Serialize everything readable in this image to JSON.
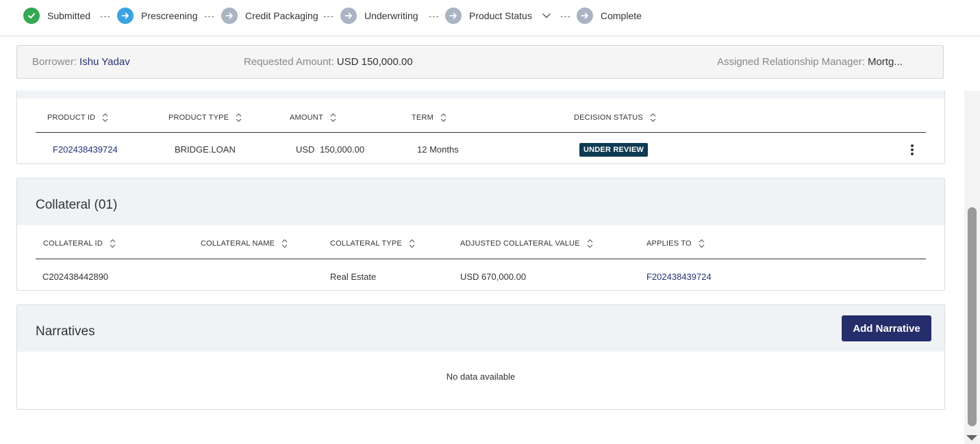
{
  "stepper": {
    "steps": [
      {
        "label": "Submitted",
        "state": "done"
      },
      {
        "label": "Prescreening",
        "state": "current"
      },
      {
        "label": "Credit Packaging",
        "state": "pending"
      },
      {
        "label": "Underwriting",
        "state": "pending"
      },
      {
        "label": "Product Status",
        "state": "pending"
      },
      {
        "label": "Complete",
        "state": "pending"
      }
    ],
    "separator": "---"
  },
  "borrower": {
    "borrower_label": "Borrower:",
    "borrower_value": "Ishu Yadav",
    "amount_label": "Requested Amount:",
    "amount_value": "USD 150,000.00",
    "manager_label": "Assigned Relationship Manager:",
    "manager_value": "Mortg..."
  },
  "products": {
    "columns": [
      "PRODUCT ID",
      "PRODUCT TYPE",
      "AMOUNT",
      "TERM",
      "DECISION STATUS"
    ],
    "rows": [
      {
        "id": "F202438439724",
        "type": "BRIDGE.LOAN",
        "currency": "USD",
        "amount": "150,000.00",
        "term": "12 Months",
        "status": "UNDER REVIEW"
      }
    ]
  },
  "collateral": {
    "title": "Collateral (01)",
    "columns": [
      "COLLATERAL ID",
      "COLLATERAL NAME",
      "COLLATERAL TYPE",
      "ADJUSTED COLLATERAL VALUE",
      "APPLIES TO"
    ],
    "rows": [
      {
        "id": "C202438442890",
        "name": "",
        "type": "Real Estate",
        "value": "USD 670,000.00",
        "applies_to": "F202438439724"
      }
    ]
  },
  "narratives": {
    "title": "Narratives",
    "add_label": "Add Narrative",
    "empty_text": "No data available"
  },
  "colors": {
    "done": "#34a853",
    "current": "#3aa3e0",
    "pending": "#aab4c3",
    "primary": "#262d6b",
    "badge": "#0e3a52"
  }
}
